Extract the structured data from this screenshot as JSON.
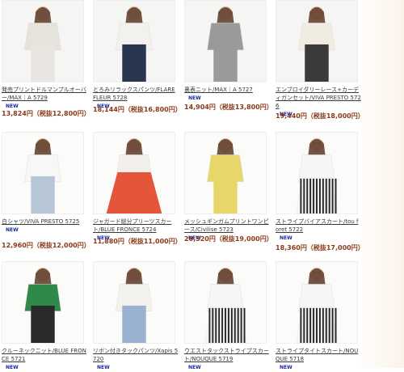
{
  "products": [
    {
      "name": "発売プリントドルマンプルオーバー/MAX｜A 5729",
      "new_label": "NEW",
      "price": "13,824円（税抜12,800円）",
      "colors": {
        "top": "#e6e2dc",
        "bottom": "#e9e6e2",
        "skin": "#e6c3a6"
      }
    },
    {
      "name": "とろみリラックスパンツ/FLARE FLEUR 5728",
      "new_label": "NEW",
      "price": "18,144円（税抜16,800円）",
      "colors": {
        "top": "#f3f1ee",
        "bottom": "#2a3550",
        "skin": "#e6c3a6"
      }
    },
    {
      "name": "裏表ニット/MAX｜A 5727",
      "new_label": "NEW",
      "price": "14,904円（税抜13,800円）",
      "colors": {
        "top": "#9a9a9a",
        "bottom": "#9a9a9a",
        "skin": "#e6c3a6"
      }
    },
    {
      "name": "エンブロイダリーレース+カーディガンセット/VIVA PRESTO 5726",
      "new_label": "NEW",
      "price": "19,440円（税抜18,000円）",
      "colors": {
        "top": "#f1ece2",
        "bottom": "#3a3a3a",
        "skin": "#e6c3a6"
      }
    },
    {
      "name": "白シャツ/VIVA PRESTO 5725",
      "new_label": "NEW",
      "price": "12,960円（税抜12,000円）",
      "colors": {
        "top": "#f7f7f5",
        "bottom": "#b7c6d6",
        "skin": "#e6c3a6"
      }
    },
    {
      "name": "ジャガード総分プリーツスカート/BLUE FRONCE 5724",
      "new_label": "NEW",
      "price": "11,880円（税抜11,000円）",
      "colors": {
        "top": "#f3f0ec",
        "bottom": "#e5553a",
        "skin": "#e6c3a6"
      }
    },
    {
      "name": "メッシュギンガムプリントワンピース/Civilise 5723",
      "new_label": "NEW",
      "price": "20,520円（税抜19,000円）",
      "colors": {
        "top": "#e9d66b",
        "bottom": "#e9d66b",
        "skin": "#e6c3a6"
      }
    },
    {
      "name": "ストライプバイアスカート/tou foret 5722",
      "new_label": "NEW",
      "price": "18,360円（税抜17,000円）",
      "colors": {
        "top": "#f6f6f6",
        "bottom": "#2a2a2a",
        "skin": "#e6c3a6"
      }
    },
    {
      "name": "クルーネックニット/BLUE FRONCE 5721",
      "new_label": "NEW",
      "price": "",
      "colors": {
        "top": "#2f8a4a",
        "bottom": "#2a2a2a",
        "skin": "#e6c3a6"
      }
    },
    {
      "name": "リボン付きタックパンツ/Xapis 5720",
      "new_label": "NEW",
      "price": "",
      "colors": {
        "top": "#f4f2ef",
        "bottom": "#9ab2cf",
        "skin": "#e6c3a6"
      }
    },
    {
      "name": "ウエストタックストライプスカート/NOUQUE 5719",
      "new_label": "NEW",
      "price": "",
      "colors": {
        "top": "#f6f6f6",
        "bottom": "#2a2a2a",
        "skin": "#e6c3a6"
      }
    },
    {
      "name": "ストライプタイトスカート/NOUQUE 5718",
      "new_label": "NEW",
      "price": "",
      "colors": {
        "top": "#f6f6f6",
        "bottom": "#2a2a2a",
        "skin": "#e6c3a6"
      }
    }
  ]
}
